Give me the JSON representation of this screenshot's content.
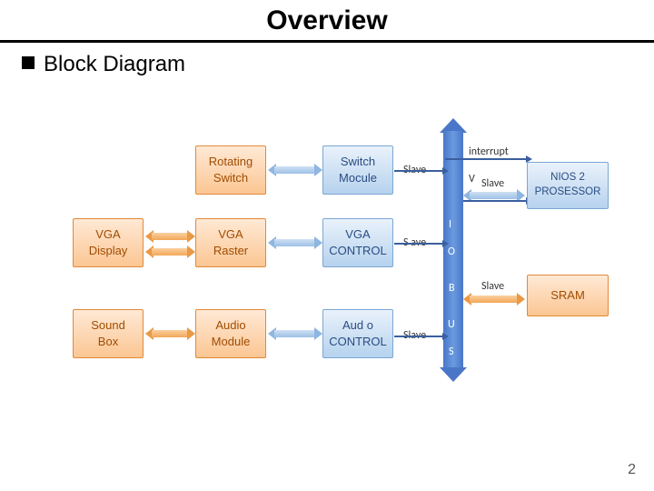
{
  "title": "Overview",
  "section": "Block Diagram",
  "page_number": "2",
  "labels": {
    "interrupt": "interrupt",
    "slave1": "Slave",
    "slave2": "S ave",
    "slave3": "Slave",
    "slave4": "Slave",
    "slave5": "Slave"
  },
  "blocks": {
    "rot_switch_l1": "Rotating",
    "rot_switch_l2": "Switch",
    "sw_mod_l1": "Switch",
    "sw_mod_l2": "Mocule",
    "nios_l1": "NIOS 2",
    "nios_l2": "PROSESSOR",
    "vga_disp_l1": "VGA",
    "vga_disp_l2": "Display",
    "vga_rast_l1": "VGA",
    "vga_rast_l2": "Raster",
    "vga_ctrl_l1": "VGA",
    "vga_ctrl_l2": "CONTROL",
    "sram": "SRAM",
    "sound_l1": "Sound",
    "sound_l2": "Box",
    "audio_mod_l1": "Audio",
    "audio_mod_l2": "Module",
    "audio_ctrl_l1": "Aud o",
    "audio_ctrl_l2": "CONTROL"
  },
  "bus": {
    "letters": [
      "V",
      "I",
      "O",
      "B",
      "U",
      "S"
    ]
  }
}
